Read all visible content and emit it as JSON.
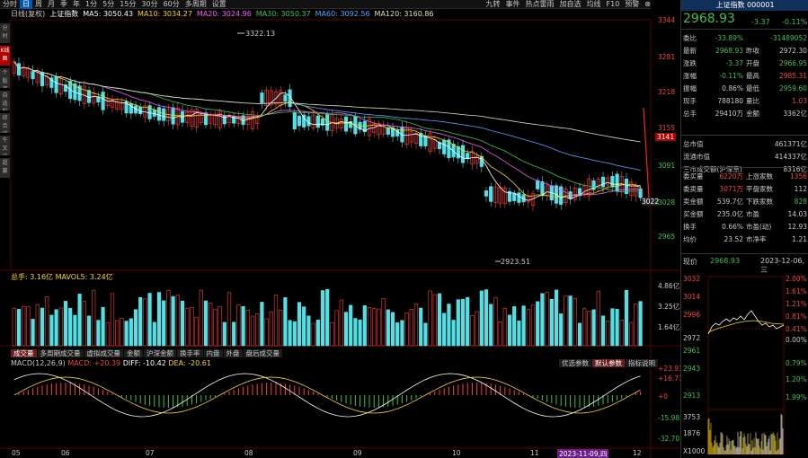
{
  "periods": [
    "分时",
    "日",
    "周",
    "月",
    "季",
    "年",
    "1分",
    "5分",
    "15分",
    "30分",
    "60分",
    "多周期",
    "设置"
  ],
  "active_period": 1,
  "toolbar_right": [
    "九转",
    "事件",
    "热点雷雨",
    "加自选",
    "均线",
    "F10",
    "预警"
  ],
  "left_tabs": [
    "分时",
    "K线图",
    "个股资料",
    "自选股",
    "综合排名",
    "牛叉诊断",
    "超赢"
  ],
  "left_active": 1,
  "ma_legend": {
    "name": "日线(复权)",
    "index": "上证指数",
    "items": [
      {
        "label": "MA5: 3050.43",
        "color": "#ffffff"
      },
      {
        "label": "MA10: 3034.27",
        "color": "#ffd700"
      },
      {
        "label": "MA20: 3024.96",
        "color": "#ff55ff"
      },
      {
        "label": "MA30: 3050.37",
        "color": "#35c44a"
      },
      {
        "label": "MA60: 3092.56",
        "color": "#4aa8ff"
      },
      {
        "label": "MA120: 3160.86",
        "color": "#e0e0b0"
      }
    ]
  },
  "price_axis": [
    "3344",
    "3281",
    "3218",
    "3155",
    "3091",
    "3028",
    "2965"
  ],
  "price_axis_special": {
    "highlight": "3141",
    "current": "3022"
  },
  "annotations": {
    "high": "3322.13",
    "low": "2923.51"
  },
  "volume": {
    "header": "总手: 3.16亿 MAVOL5: 3.24亿",
    "axis": [
      "4.86亿",
      "3.25亿",
      "1.64亿"
    ]
  },
  "indicator_tabs": [
    "成交量",
    "多周期成交量",
    "虚拟成交量",
    "金额",
    "沪深金额",
    "换手率",
    "内盘",
    "外盘",
    "盘后成交量"
  ],
  "indicator_active": 0,
  "macd": {
    "header": {
      "name": "MACD(12,26,9)",
      "macd": "MACD: +20.39",
      "diff": "DIFF: -10.42",
      "dea": "DEA: -20.61"
    },
    "buttons": [
      "优选参数",
      "默认参数",
      "指标说明"
    ],
    "axis": [
      "+23.93",
      "+16.71",
      "+0",
      "-15.98",
      "-32.70"
    ]
  },
  "date_axis": [
    "05",
    "06",
    "07",
    "08",
    "09",
    "10",
    "11",
    "12"
  ],
  "date_highlight": "2023-11-09,四",
  "quote": {
    "title": "上证指数 000001",
    "price": "2968.93",
    "change": "-3.37",
    "pct": "-0.11%",
    "rows": [
      {
        "l": "委比",
        "m": "-33.89%",
        "l2": "",
        "r": "-31489052",
        "mc": "green",
        "rc": "green"
      },
      {
        "l": "最新",
        "m": "2968.93",
        "l2": "昨收",
        "r": "2972.30",
        "mc": "green",
        "rc": ""
      },
      {
        "l": "涨跌",
        "m": "-3.37",
        "l2": "开盘",
        "r": "2966.95",
        "mc": "green",
        "rc": "green"
      },
      {
        "l": "涨幅",
        "m": "-0.11%",
        "l2": "最高",
        "r": "2985.31",
        "mc": "green",
        "rc": "red"
      },
      {
        "l": "振幅",
        "m": "0.86%",
        "l2": "最低",
        "r": "2959.60",
        "mc": "",
        "rc": "green"
      },
      {
        "l": "现手",
        "m": "788180",
        "l2": "量比",
        "r": "1.03",
        "mc": "",
        "rc": "red"
      },
      {
        "l": "总手",
        "m": "29410万",
        "l2": "金额",
        "r": "3362亿",
        "mc": "",
        "rc": ""
      }
    ],
    "rows2": [
      {
        "l": "总市值",
        "r": "461371亿"
      },
      {
        "l": "流通市值",
        "r": "414337亿"
      },
      {
        "l": "三市成交额(沪深京)",
        "r": "8316亿"
      }
    ],
    "rows3": [
      {
        "l": "委买量",
        "m": "6220万",
        "l2": "上涨家数",
        "r": "1356",
        "mc": "red",
        "rc": "red"
      },
      {
        "l": "委卖量",
        "m": "3071万",
        "l2": "平盘家数",
        "r": "112",
        "mc": "red",
        "rc": ""
      },
      {
        "l": "卖金额",
        "m": "539.7亿",
        "l2": "下跌家数",
        "r": "828",
        "mc": "",
        "rc": "green"
      },
      {
        "l": "买金额",
        "m": "235.0亿",
        "l2": "市盈",
        "r": "14.03",
        "mc": "",
        "rc": ""
      },
      {
        "l": "换手",
        "m": "0.66%",
        "l2": "市盈(动)",
        "r": "12.93",
        "mc": "",
        "rc": ""
      },
      {
        "l": "均价",
        "m": "23.52",
        "l2": "市净率",
        "r": "1.21",
        "mc": "",
        "rc": ""
      }
    ],
    "current_label": "现价",
    "current_price": "2968.93",
    "current_date": "2023-12-06,三"
  },
  "intraday": {
    "left_axis": [
      "3032",
      "3014",
      "2996",
      "2972",
      "2961",
      "2943",
      "2913",
      "3753",
      "1876",
      "X1000"
    ],
    "right_axis": [
      "2.00%",
      "1.61%",
      "1.21%",
      "0.81%",
      "0.41%",
      "0.00%",
      "0.79%",
      "1.20%",
      "1.99%"
    ]
  }
}
